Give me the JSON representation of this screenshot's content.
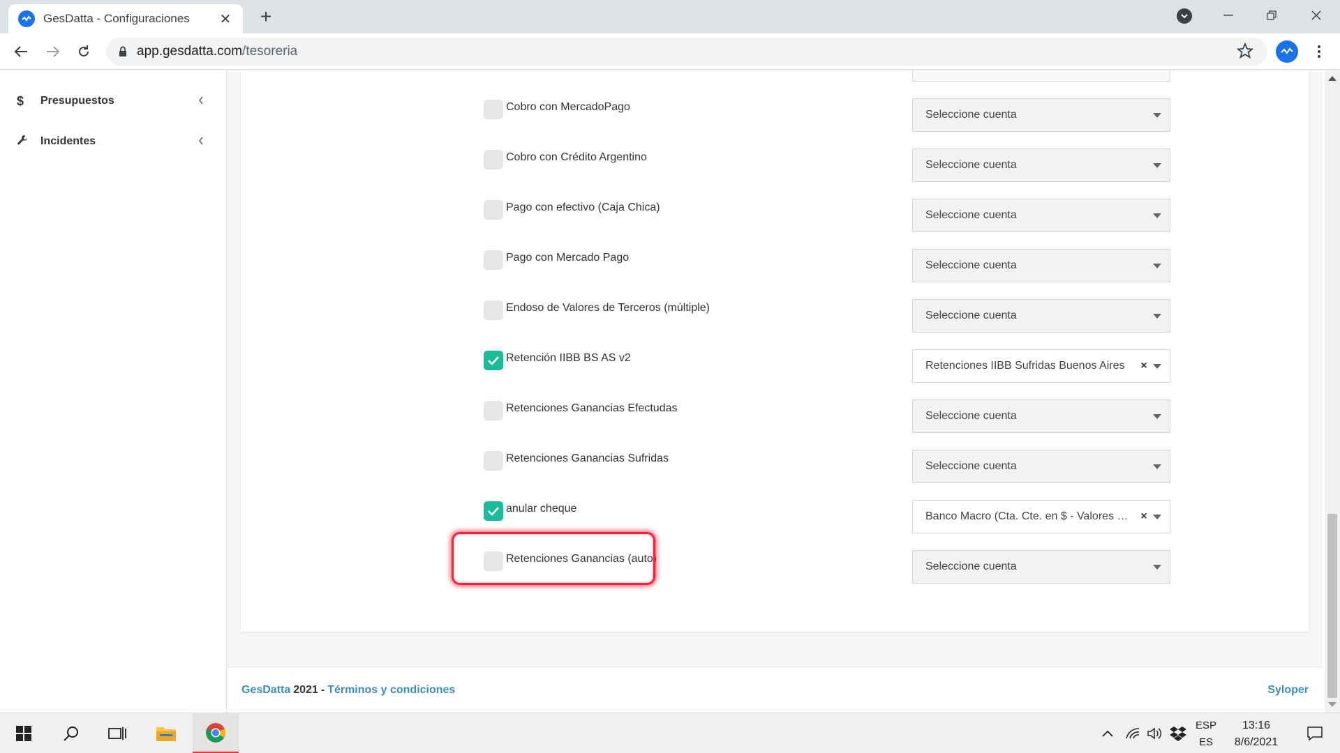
{
  "browser": {
    "tab_title": "GesDatta - Configuraciones",
    "url_host": "app.gesdatta.com",
    "url_path": "/tesoreria"
  },
  "sidebar": {
    "items": [
      {
        "icon": "$",
        "label": "Presupuestos"
      },
      {
        "icon": "wrench",
        "label": "Incidentes"
      }
    ]
  },
  "rows": [
    {
      "label": "Cobro con MercadoPago",
      "checked": false,
      "account": "Seleccione cuenta"
    },
    {
      "label": "Cobro con Crédito Argentino",
      "checked": false,
      "account": "Seleccione cuenta"
    },
    {
      "label": "Pago con efectivo (Caja Chica)",
      "checked": false,
      "account": "Seleccione cuenta"
    },
    {
      "label": "Pago con Mercado Pago",
      "checked": false,
      "account": "Seleccione cuenta"
    },
    {
      "label": "Endoso de Valores de Terceros (múltiple)",
      "checked": false,
      "account": "Seleccione cuenta"
    },
    {
      "label": "Retención IIBB BS AS v2",
      "checked": true,
      "account": "Retenciones IIBB Sufridas Buenos Aires"
    },
    {
      "label": "Retenciones Ganancias Efectudas",
      "checked": false,
      "account": "Seleccione cuenta"
    },
    {
      "label": "Retenciones Ganancias Sufridas",
      "checked": false,
      "account": "Seleccione cuenta"
    },
    {
      "label": "anular cheque",
      "checked": true,
      "account": "Banco Macro (Cta. Cte. en $ - Valores Difer..."
    },
    {
      "label": "Retenciones Ganancias (auto)",
      "checked": false,
      "account": "Seleccione cuenta"
    }
  ],
  "footer": {
    "brand": "GesDatta",
    "year": "2021",
    "separator": "-",
    "terms": "Términos y condiciones",
    "right": "Syloper"
  },
  "taskbar": {
    "lang_top": "ESP",
    "lang_bottom": "ES",
    "time": "13:16",
    "date": "8/6/2021"
  },
  "colors": {
    "accent_link": "#3c8dbc",
    "checkbox_checked": "#1abc9c",
    "highlight": "#ff1f3d"
  }
}
